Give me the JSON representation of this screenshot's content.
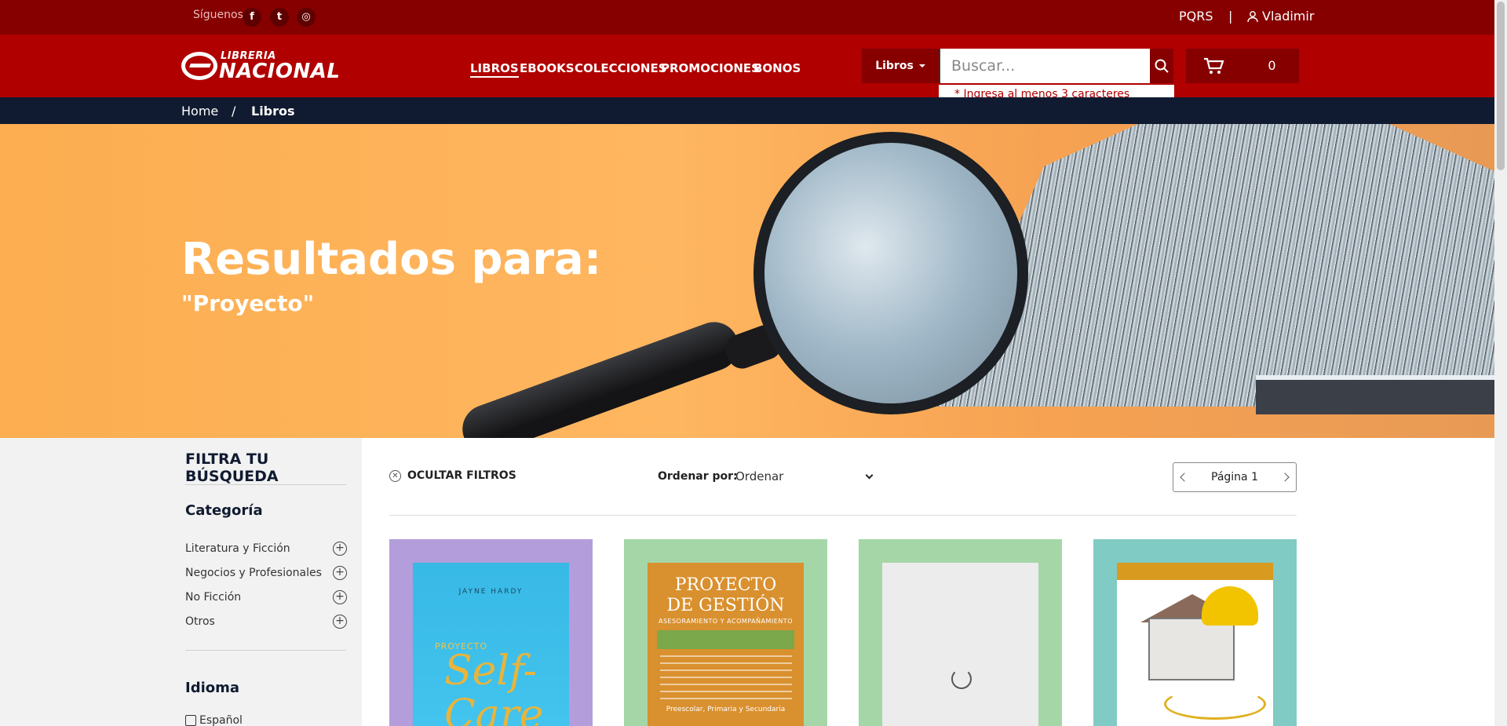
{
  "topbar": {
    "follow_label": "Síguenos",
    "social": [
      {
        "name": "facebook-icon",
        "glyph": "f"
      },
      {
        "name": "twitter-icon",
        "glyph": "t"
      },
      {
        "name": "instagram-icon",
        "glyph": "◎"
      }
    ],
    "pqrs": "PQRS",
    "separator": "|",
    "user": "Vladimir"
  },
  "header": {
    "logo_small": "LIBRERIA",
    "logo_big": "NACIONAL",
    "nav": [
      "LIBROS",
      "EBOOKS",
      "COLECCIONES",
      "PROMOCIONES",
      "BONOS"
    ],
    "active_nav": "LIBROS",
    "category_select": "Libros",
    "search_placeholder": "Buscar...",
    "search_hint": "* Ingresa al menos 3 caracteres",
    "cart_count": "0"
  },
  "breadcrumb": {
    "home": "Home",
    "separator": "/",
    "current": "Libros"
  },
  "hero": {
    "title": "Resultados para:",
    "query": "\"Proyecto\""
  },
  "sidebar": {
    "title": "FILTRA TU BÚSQUEDA",
    "category_heading": "Categoría",
    "categories": [
      "Literatura y Ficción",
      "Negocios y Profesionales",
      "No Ficción",
      "Otros"
    ],
    "language_heading": "Idioma",
    "languages": [
      "Español"
    ]
  },
  "toolbar": {
    "hide_filters": "OCULTAR FILTROS",
    "order_label": "Ordenar por:",
    "order_value": "Ordenar",
    "page_label": "Página 1"
  },
  "products": [
    {
      "bg": "#b39ddb",
      "author": "JAYNE HARDY",
      "title_small": "PROYECTO",
      "title_big": "Self-Care"
    },
    {
      "bg": "#a5d6a7",
      "title_line1": "PROYECTO",
      "title_line2": "DE GESTIÓN",
      "subtitle": "ASESORAMIENTO Y ACOMPAÑAMIENTO",
      "footer": "Preescolar, Primaria y Secundaria"
    },
    {
      "bg": "#a5d6a7"
    },
    {
      "bg": "#80cbc4"
    }
  ],
  "colors": {
    "brand_red": "#b00000",
    "dark_red": "#860000",
    "navy": "#101b31"
  }
}
